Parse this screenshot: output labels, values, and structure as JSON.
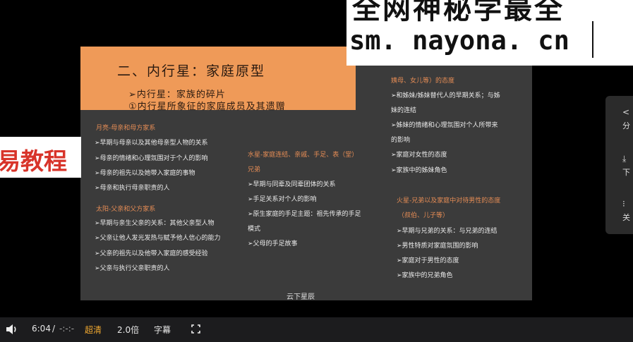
{
  "slide": {
    "title": "二、内行星：家庭原型",
    "subtitle1": "➢内行星：家族的碎片",
    "subtitle2": "①内行星所象征的家庭成员及其遗赠",
    "col1": {
      "moon_head": "月亮-母亲和母方家系",
      "moon_items": [
        "➢早期与母亲以及其他母亲型人物的关系",
        "➢母亲的情绪和心理氛围对于个人的影响",
        "➢母亲的祖先以及她带入家庭的事物",
        "➢母亲和执行母亲职责的人"
      ],
      "sun_head": "太阳-父亲和父方家系",
      "sun_items": [
        "➢早期与亲生父亲的关系：其他父亲型人物",
        "➢父亲让他人发光发热与赋予他人信心的能力",
        "➢父亲的祖先以及他带入家庭的感受经验",
        "➢父亲与执行父亲职责的人"
      ]
    },
    "col2": {
      "mercury_head": "水星-家庭连结、亲戚、手足、表（堂）",
      "mercury_head2": "兄弟",
      "mercury_items": [
        "➢早期与同辈及同辈团体的关系",
        "➢手足关系对个人的影响",
        "➢原生家庭的手足主题：祖先传承的手足",
        "模式",
        "➢父母的手足故事"
      ]
    },
    "col3": {
      "venus_head2": "姨母、女儿等）的态度",
      "venus_items": [
        "➢和姊妹/姊妹替代人的早期关系；与姊",
        "妹的连结",
        "➢姊妹的情绪和心理氛围对个人所带来",
        "的影响",
        "➢家庭对女性的态度",
        "➢家族中的姊妹角色"
      ],
      "mars_head": "火星-兄弟以及家庭中对待男性的态度",
      "mars_head2": "（叔伯、儿子等）",
      "mars_items": [
        "➢早期与兄弟的关系：与兄弟的连结",
        "➢男性特质对家庭氛围的影响",
        "➢家庭对于男性的态度",
        "➢家族中的兄弟角色"
      ]
    },
    "footer": "云下星辰"
  },
  "watermark": {
    "top_text": "全网神秘学最全",
    "url": "sm. nayona. cn"
  },
  "side_tag": "易教程",
  "side_panel": {
    "share": "分",
    "download": "下",
    "close": "关"
  },
  "controls": {
    "time_current": "6:04",
    "time_sep": "/",
    "time_total": "-:-:-",
    "quality": "超清",
    "speed": "2.0倍",
    "subtitle": "字幕"
  },
  "colors": {
    "slide_bg": "#3b3b3b",
    "banner": "#ef9a58",
    "heading": "#e58c55",
    "quality_accent": "#f0a830",
    "tag_red": "#d8342a"
  }
}
